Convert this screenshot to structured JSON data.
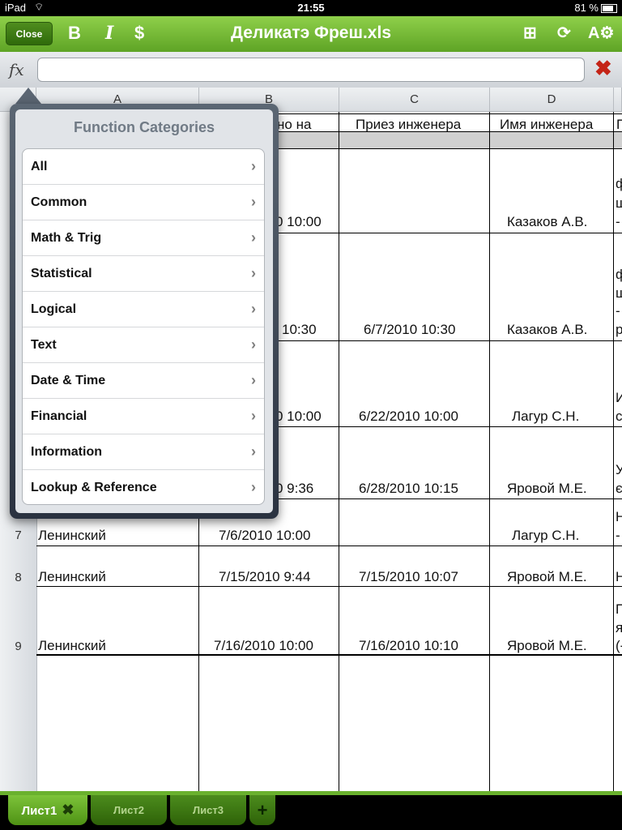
{
  "status": {
    "device": "iPad",
    "time": "21:55",
    "battery": "81 %"
  },
  "toolbar": {
    "close_label": "Close",
    "bold_label": "B",
    "italic_label": "I",
    "currency_label": "$",
    "title": "Деликатэ Фреш.xls"
  },
  "formula_bar": {
    "fx_label": "fx",
    "value": ""
  },
  "columns": [
    "A",
    "B",
    "C",
    "D"
  ],
  "header_row": {
    "b": "но на",
    "c": "Приез инженера",
    "d": "Имя инженера",
    "e": "П"
  },
  "rows": [
    {
      "b": "0 10:00",
      "c": "",
      "d": "Казаков А.В.",
      "e1": "ф",
      "e2": "ш",
      "e3": "-"
    },
    {
      "b": "10:30",
      "c": "6/7/2010 10:30",
      "d": "Казаков А.В.",
      "e1": "ф",
      "e2": "ш",
      "e3": "-",
      "e4": "р"
    },
    {
      "b": "0 10:00",
      "c": "6/22/2010 10:00",
      "d": "Лагур  С.Н.",
      "e1": "И",
      "e2": "с"
    },
    {
      "b": "0 9:36",
      "c": "6/28/2010 10:15",
      "d": "Яровой М.Е.",
      "e1": "У",
      "e2": "є"
    },
    {
      "num": "7",
      "a": "Ленинский",
      "b": "7/6/2010 10:00",
      "c": "",
      "d": "Лагур  С.Н.",
      "e1": "Н",
      "e2": "-"
    },
    {
      "num": "8",
      "a": "Ленинский",
      "b": "7/15/2010 9:44",
      "c": "7/15/2010 10:07",
      "d": "Яровой М.Е.",
      "e1": "Н"
    },
    {
      "num": "9",
      "a": "Ленинский",
      "b": "7/16/2010 10:00",
      "c": "7/16/2010 10:10",
      "d": "Яровой М.Е.",
      "e1": "П",
      "e2": "я",
      "e3": "(-"
    }
  ],
  "popover": {
    "title": "Function Categories",
    "items": [
      "All",
      "Common",
      "Math & Trig",
      "Statistical",
      "Logical",
      "Text",
      "Date & Time",
      "Financial",
      "Information",
      "Lookup & Reference"
    ]
  },
  "sheets": {
    "s1": "Лист1",
    "s2": "Лист2",
    "s3": "Лист3",
    "add": "+"
  }
}
